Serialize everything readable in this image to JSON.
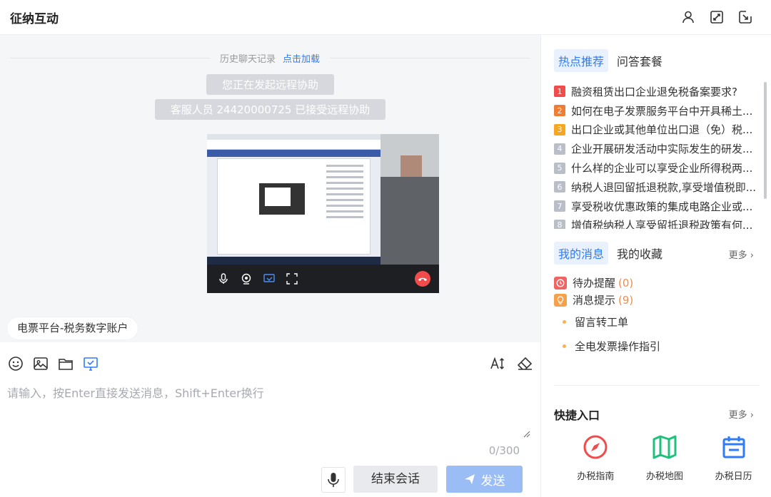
{
  "app": {
    "title": "征纳互动"
  },
  "header": {
    "icons": [
      "user-icon",
      "expand-icon",
      "exit-icon"
    ]
  },
  "chat": {
    "history_label": "历史聊天记录",
    "history_link": "点击加载",
    "system_messages": [
      "您正在发起远程协助",
      "客服人员 24420000725 已接受远程协助"
    ],
    "quick_tag": "电票平台-税务数字账户"
  },
  "input": {
    "placeholder": "请输入，按Enter直接发送消息，Shift+Enter换行",
    "counter": "0/300",
    "end_label": "结束会话",
    "send_label": "发送"
  },
  "hot": {
    "tabs": [
      "热点推荐",
      "问答套餐"
    ],
    "items": [
      {
        "num": "1",
        "text": "融资租赁出口企业退免税备案要求?",
        "color": "#f04c4c"
      },
      {
        "num": "2",
        "text": "如何在电子发票服务平台中开具稀土...",
        "color": "#f07d35"
      },
      {
        "num": "3",
        "text": "出口企业或其他单位出口退（免）税...",
        "color": "#f5a623"
      },
      {
        "num": "4",
        "text": "企业开展研发活动中实际发生的研发...",
        "color": "#b9bec8"
      },
      {
        "num": "5",
        "text": "什么样的企业可以享受企业所得税两...",
        "color": "#b9bec8"
      },
      {
        "num": "6",
        "text": "纳税人退回留抵退税款,享受增值税即...",
        "color": "#b9bec8"
      },
      {
        "num": "7",
        "text": "享受税收优惠政策的集成电路企业或...",
        "color": "#b9bec8"
      },
      {
        "num": "8",
        "text": "增值税纳税人享受留抵退税政策有何...",
        "color": "#b9bec8"
      }
    ]
  },
  "messages": {
    "tabs": [
      "我的消息",
      "我的收藏"
    ],
    "more": "更多",
    "todo_label": "待办提醒",
    "todo_count": "(0)",
    "notice_label": "消息提示",
    "notice_count": "(9)",
    "bullets": [
      "留言转工单",
      "全电发票操作指引"
    ]
  },
  "shortcuts": {
    "title": "快捷入口",
    "more": "更多",
    "items": [
      {
        "label": "办税指南",
        "icon": "compass-icon",
        "color": "#f04c4c"
      },
      {
        "label": "办税地图",
        "icon": "map-icon",
        "color": "#1fc07a"
      },
      {
        "label": "办税日历",
        "icon": "calendar-icon",
        "color": "#2f7cf6"
      }
    ]
  }
}
